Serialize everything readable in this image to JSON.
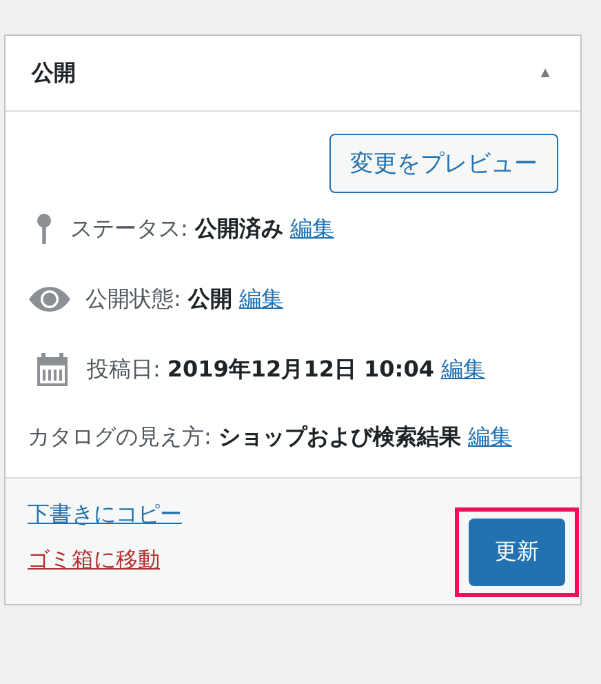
{
  "panel": {
    "title": "公開",
    "collapse_icon": "▲"
  },
  "preview_button": {
    "label": "変更をプレビュー"
  },
  "rows": [
    {
      "kind": "status",
      "label": "ステータス:",
      "value": "公開済み",
      "edit": "編集"
    },
    {
      "kind": "visibility",
      "label": "公開状態:",
      "value": "公開",
      "edit": "編集"
    },
    {
      "kind": "date",
      "label": "投稿日:",
      "value": "2019年12月12日 10:04",
      "edit": "編集"
    },
    {
      "kind": "catalog",
      "label": "カタログの見え方:",
      "value": "ショップおよび検索結果",
      "edit": "編集"
    }
  ],
  "footer": {
    "copy_link": "下書きにコピー",
    "trash_link": "ゴミ箱に移動",
    "update_button": {
      "label": "更新",
      "highlighted": true
    }
  }
}
